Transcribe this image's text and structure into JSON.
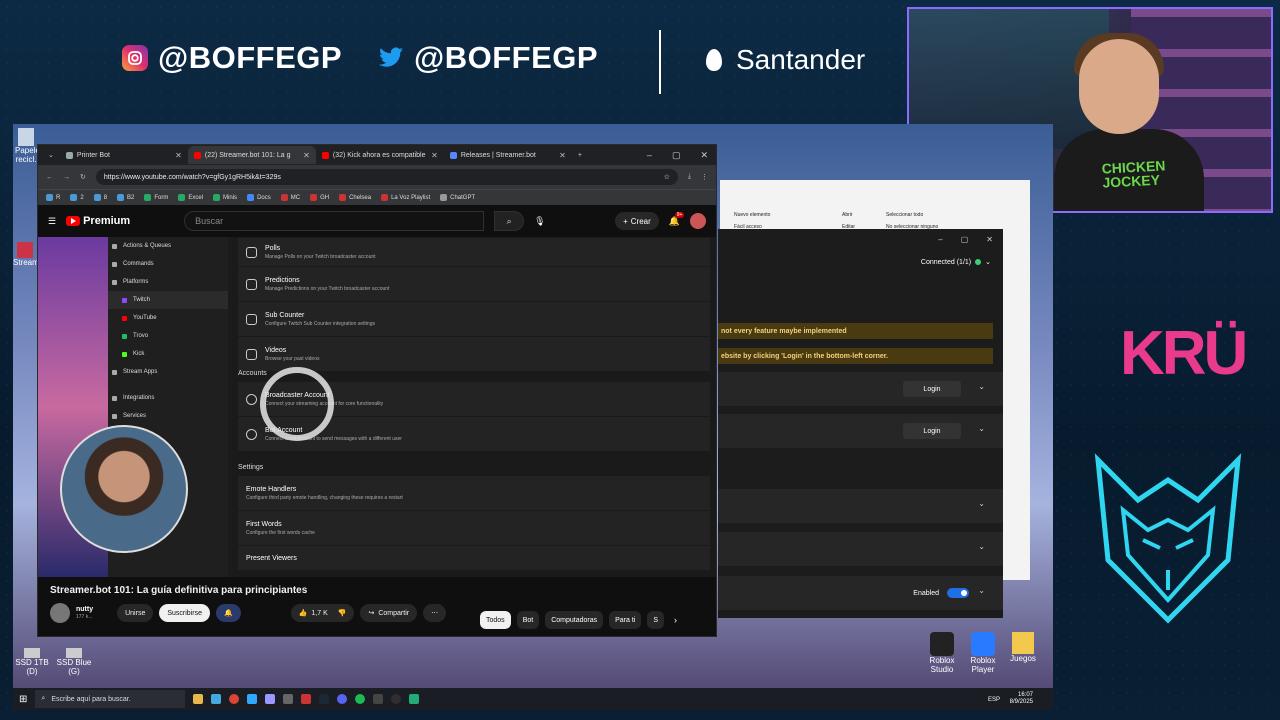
{
  "overlay": {
    "instagram": "@BOFFEGP",
    "twitter": "@BOFFEGP",
    "sponsor": "Santander",
    "kru": "KRÜ",
    "shirt_text": "CHICKEN JOCKEY"
  },
  "desktop_icons": [
    "Papeler. recicl.",
    "Stream",
    "SSD 1TB (D)",
    "SSD Blue (G)",
    "Roblox Studio",
    "Roblox Player",
    "Juegos"
  ],
  "browser": {
    "tabs": [
      {
        "label": "Printer Bot",
        "active": false
      },
      {
        "label": "(22) Streamer.bot 101: La g",
        "active": true
      },
      {
        "label": "(32) Kick ahora es compatible",
        "active": false
      },
      {
        "label": "Releases | Streamer.bot",
        "active": false
      }
    ],
    "url": "https://www.youtube.com/watch?v=gfGy1gRH5ik&t=329s",
    "bookmarks": [
      "R",
      "2",
      "8",
      "B2",
      "Form",
      "Excel",
      "Minis",
      "Docs",
      "MC",
      "GH",
      "Chelsea",
      "La Voz Playlist",
      "ChatGPT"
    ]
  },
  "youtube": {
    "logo": "Premium",
    "search_placeholder": "Buscar",
    "create_label": "Crear",
    "notif_count": "9+",
    "video_title": "Streamer.bot 101: La guía definitiva para principiantes",
    "channel": "nutty",
    "subs": "177 k...",
    "join_label": "Unirse",
    "subscribe_label": "Suscribirse",
    "likes": "1,7 K",
    "share_label": "Compartir",
    "chips": [
      "Todos",
      "Bot",
      "Computadoras",
      "Para ti",
      "S"
    ]
  },
  "streamerbot_video": {
    "nav": [
      {
        "label": "Actions & Queues",
        "sub": false
      },
      {
        "label": "Commands",
        "sub": false
      },
      {
        "label": "Platforms",
        "sub": false
      },
      {
        "label": "Twitch",
        "sub": true
      },
      {
        "label": "YouTube",
        "sub": true
      },
      {
        "label": "Trovo",
        "sub": true
      },
      {
        "label": "Kick",
        "sub": true
      },
      {
        "label": "Stream Apps",
        "sub": false
      },
      {
        "label": "Integrations",
        "sub": false
      },
      {
        "label": "Services",
        "sub": false
      }
    ],
    "rows_top": [
      {
        "title": "Polls",
        "desc": "Manage Polls on your Twitch broadcaster account"
      },
      {
        "title": "Predictions",
        "desc": "Manage Predictions on your Twitch broadcaster account"
      },
      {
        "title": "Sub Counter",
        "desc": "Configure Twitch Sub Counter integration settings"
      },
      {
        "title": "Videos",
        "desc": "Browse your past videos"
      }
    ],
    "accounts_label": "Accounts",
    "rows_accounts": [
      {
        "title": "Broadcaster Account",
        "desc": "Connect your streaming account for core functionality"
      },
      {
        "title": "Bot Account",
        "desc": "Connect a bot account to send messages with a different user"
      }
    ],
    "settings_label": "Settings",
    "rows_settings": [
      {
        "title": "Emote Handlers",
        "desc": "Configure third party emote handling, changing these requires a restart"
      },
      {
        "title": "First Words",
        "desc": "Configure the first words cache"
      },
      {
        "title": "Present Viewers",
        "desc": ""
      }
    ]
  },
  "explorer": {
    "items": [
      "Nuevo elemento",
      "Fácil acceso",
      "Abrir",
      "Editar",
      "Seleccionar todo",
      "No seleccionar ninguno"
    ]
  },
  "streamerbot_app": {
    "connected": "Connected (1/1)",
    "banner1": "not every feature maybe implemented",
    "banner2": "ebsite by clicking 'Login' in the bottom-left corner.",
    "login1": "Login",
    "login2": "Login",
    "enabled": "Enabled"
  },
  "taskbar": {
    "search": "Escribe aquí para buscar.",
    "lang": "ESP",
    "time": "16:07",
    "date": "8/9/2025"
  }
}
